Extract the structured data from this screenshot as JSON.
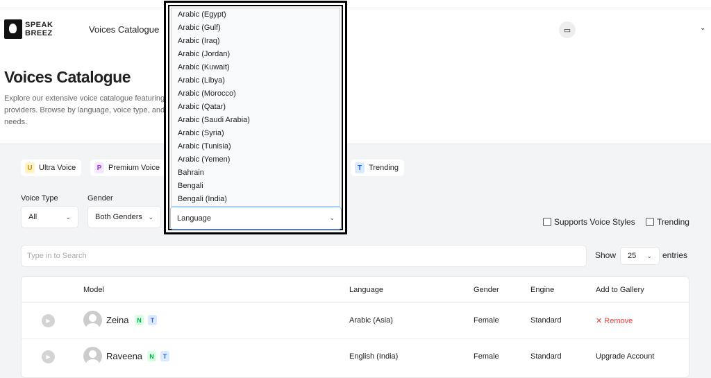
{
  "header": {
    "logo_line1": "SPEAK",
    "logo_line2": "BREEZ",
    "nav_item": "Voices Catalogue"
  },
  "page": {
    "title": "Voices Catalogue",
    "description": "Explore our extensive voice catalogue featuring a",
    "description_line2": "providers. Browse by language, voice type, and g",
    "description_line3": "needs."
  },
  "chips": [
    {
      "badge": "U",
      "label": "Ultra Voice",
      "color": "#ca8a04",
      "bg": "#fef3c7"
    },
    {
      "badge": "P",
      "label": "Premium Voice",
      "color": "#9333ea",
      "bg": "#f3e8ff"
    },
    {
      "badge": "T",
      "label": "Trending",
      "color": "#2563eb",
      "bg": "#dbeafe"
    }
  ],
  "filters": {
    "voice_type_label": "Voice Type",
    "voice_type_value": "All",
    "gender_label": "Gender",
    "gender_value": "Both Genders",
    "language_value": "Language",
    "supports_styles": "Supports Voice Styles",
    "trending": "Trending"
  },
  "language_options": [
    "Arabic (Egypt)",
    "Arabic (Gulf)",
    "Arabic (Iraq)",
    "Arabic (Jordan)",
    "Arabic (Kuwait)",
    "Arabic (Libya)",
    "Arabic (Morocco)",
    "Arabic (Qatar)",
    "Arabic (Saudi Arabia)",
    "Arabic (Syria)",
    "Arabic (Tunisia)",
    "Arabic (Yemen)",
    "Bahrain",
    "Bengali",
    "Bengali (India)"
  ],
  "search": {
    "placeholder": "Type in to Search",
    "show": "Show",
    "entries_value": "25",
    "entries": "entries"
  },
  "table": {
    "headers": {
      "model": "Model",
      "language": "Language",
      "gender": "Gender",
      "engine": "Engine",
      "gallery": "Add to Gallery"
    },
    "rows": [
      {
        "name": "Zeina",
        "tag1": "N",
        "tag2": "T",
        "language": "Arabic (Asia)",
        "gender": "Female",
        "engine": "Standard",
        "action": "✕ Remove"
      },
      {
        "name": "Raveena",
        "tag1": "N",
        "tag2": "T",
        "language": "English (India)",
        "gender": "Female",
        "engine": "Standard",
        "action": "Upgrade Account"
      }
    ]
  }
}
